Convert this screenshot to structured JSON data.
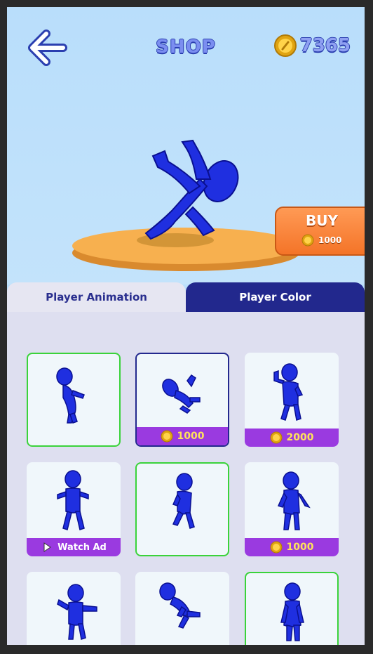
{
  "header": {
    "title": "SHOP",
    "coins": "7365"
  },
  "buy": {
    "label": "BUY",
    "price": "1000"
  },
  "tabs": {
    "animation": "Player Animation",
    "color": "Player Color"
  },
  "cards": [
    {
      "price": ""
    },
    {
      "price": "1000"
    },
    {
      "price": "2000"
    },
    {
      "price": "Watch Ad"
    },
    {
      "price": ""
    },
    {
      "price": "1000"
    },
    {
      "price": ""
    },
    {
      "price": ""
    },
    {
      "price": ""
    }
  ],
  "colors": {
    "accent": "#9a3ae0",
    "selected": "#3ad33a",
    "tab_active": "#22288d",
    "figure": "#1f2fe0",
    "buy": "#f47428"
  }
}
